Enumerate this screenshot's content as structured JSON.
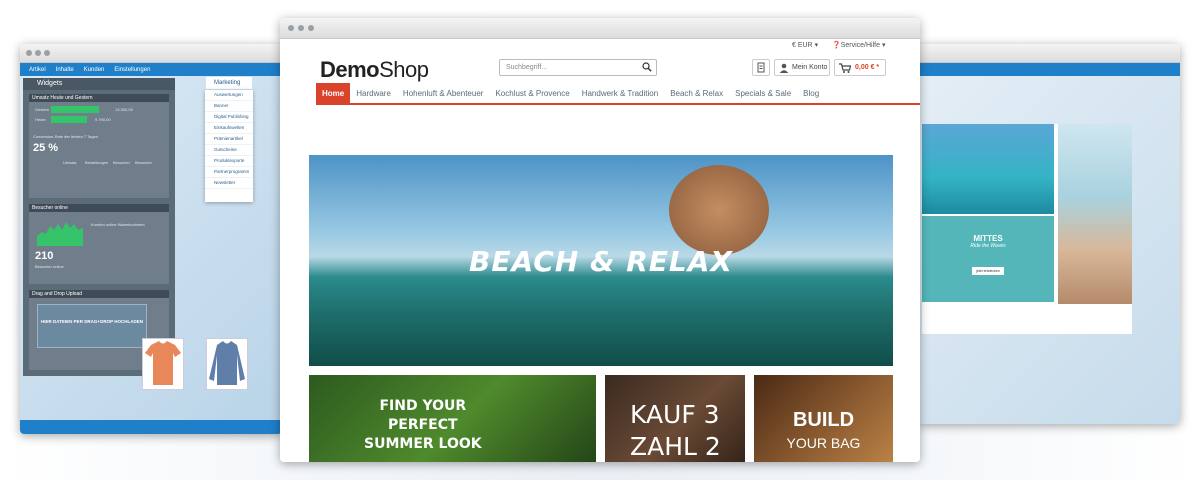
{
  "colors": {
    "accent": "#d8432a",
    "admin_blue": "#1f7fc9",
    "widget_green": "#35c46a"
  },
  "admin": {
    "topbar": [
      "Artikel",
      "Inhalte",
      "Kunden",
      "Einstellungen",
      "Marketing"
    ],
    "widgets_title": "Widgets",
    "revenue": {
      "title": "Umsatz Heute und Gestern",
      "today_label": "Gestern",
      "today_value": "13.300,00",
      "yesterday_label": "Heute",
      "yesterday_value": "9.790,00",
      "percent": "25 %",
      "note": "Conversion-Rate der letzten 7 Tagen",
      "cols": [
        "Umsatz",
        "Bestellungen",
        "Besucher",
        "Besucher"
      ]
    },
    "visitors": {
      "title": "Besucher online",
      "count": "210",
      "label": "Besucher online",
      "legend": "Kunden online    Warenkorbwert"
    },
    "upload": {
      "title": "Drag and Drop Upload",
      "dropzone": "HIER DATEIEN PER DRAG+DROP HOCHLADEN"
    },
    "marketing_menu": [
      "Auswertungen",
      "Banner",
      "Digital Publishing",
      "Einkaufswelten",
      "Prämienartikel",
      "Gutscheine",
      "Produktexporte",
      "Partnerprogramm",
      "Newsletter"
    ]
  },
  "shop": {
    "currency": "€ EUR",
    "service": "Service/Hilfe",
    "logo_bold": "Demo",
    "logo_light": "Shop",
    "search_placeholder": "Suchbegriff...",
    "account_label": "Mein Konto",
    "cart_amount": "0,00 € *",
    "nav": [
      "Home",
      "Hardware",
      "Hohenluft & Abenteuer",
      "Kochlust & Provence",
      "Handwerk & Tradition",
      "Beach & Relax",
      "Specials & Sale",
      "Blog"
    ],
    "hero_title": "BEACH & RELAX",
    "tile1": [
      "FIND YOUR",
      "PERFECT",
      "SUMMER LOOK"
    ],
    "tile2": [
      "KAUF 3",
      "ZAHL 2"
    ],
    "tile3_line1": "BUILD",
    "tile3_line2": "YOUR BAG"
  },
  "right": {
    "banner_title": "MITTES",
    "banner_sub": "Ride the Waves",
    "button": "jetzt entdecken"
  }
}
